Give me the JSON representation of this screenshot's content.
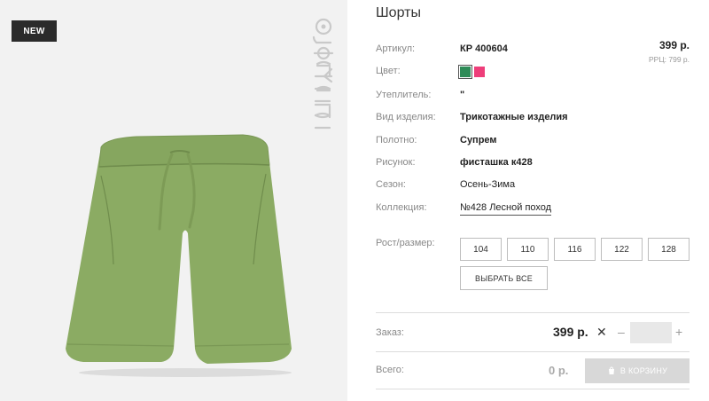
{
  "badge": {
    "label": "NEW"
  },
  "product": {
    "title": "Шорты"
  },
  "price": {
    "main": "399 р.",
    "rrp": "РРЦ: 799 р."
  },
  "specs": {
    "article_label": "Артикул:",
    "article_value": "КР 400604",
    "color_label": "Цвет:",
    "insulation_label": "Утеплитель:",
    "insulation_value": "\"",
    "type_label": "Вид изделия:",
    "type_value": "Трикотажные изделия",
    "fabric_label": "Полотно:",
    "fabric_value": "Супрем",
    "print_label": "Рисунок:",
    "print_value": "фисташка к428",
    "season_label": "Сезон:",
    "season_value": "Осень-Зима",
    "collection_label": "Коллекция:",
    "collection_value": "№428 Лесной поход"
  },
  "colors": {
    "swatches": [
      "#2e8b57",
      "#ee3e7a"
    ]
  },
  "sizes": {
    "label": "Рост/размер:",
    "options": [
      "104",
      "110",
      "116",
      "122",
      "128"
    ],
    "select_all": "ВЫБРАТЬ ВСЕ"
  },
  "order": {
    "label": "Заказ:",
    "price": "399 р.",
    "times": "✕",
    "minus": "–",
    "plus": "+",
    "quantity": ""
  },
  "total": {
    "label": "Всего:",
    "price": "0 р.",
    "cart_button": "В КОРЗИНУ"
  }
}
